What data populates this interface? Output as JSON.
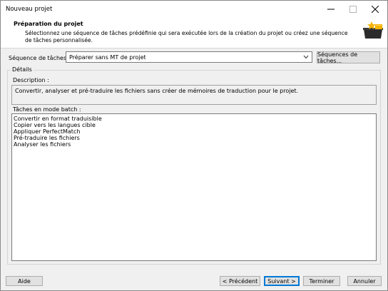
{
  "window": {
    "title": "Nouveau projet"
  },
  "header": {
    "title": "Préparation du projet",
    "description": "Sélectionnez une séquence de tâches prédéfinie qui sera exécutée lors de la création du projet ou créez une séquence de tâches personnalisée.",
    "icon": "project-preparation-icon"
  },
  "sequence": {
    "label": "Séquence de tâches :",
    "selected": "Préparer sans MT de projet",
    "button": "Séquences de tâches..."
  },
  "details": {
    "group_label": "Détails",
    "description_label": "Description :",
    "description_text": "Convertir, analyser et pré-traduire les fichiers sans créer de mémoires de traduction pour le projet.",
    "batch_label": "Tâches en mode batch :",
    "batch_tasks": [
      "Convertir en format traduisible",
      "Copier vers les langues cible",
      "Appliquer PerfectMatch",
      "Pré-traduire les fichiers",
      "Analyser les fichiers"
    ]
  },
  "footer": {
    "help": "Aide",
    "previous": "< Précédent",
    "next": "Suivant >",
    "finish": "Terminer",
    "cancel": "Annuler"
  },
  "colors": {
    "accent": "#0078d7",
    "icon_dark": "#2b2b2b",
    "icon_gold": "#f5b400"
  }
}
